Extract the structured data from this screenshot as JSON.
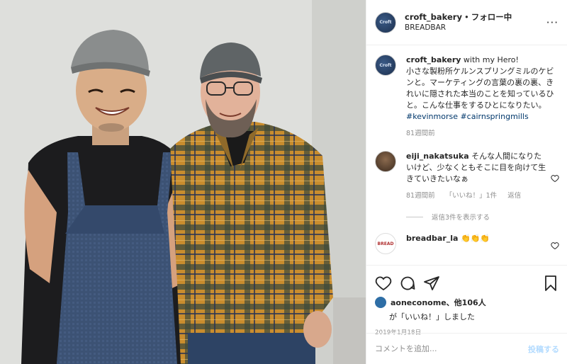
{
  "header": {
    "username": "croft_bakery",
    "separator": "•",
    "follow_status": "フォロー中",
    "location": "BREADBAR",
    "more": "···",
    "avatar_text": "Croft"
  },
  "caption": {
    "username": "croft_bakery",
    "text": "with my Hero!\n小さな製粉所ケルンスプリングミルのケビンと。マーケティングの言葉の裏の裏、きれいに隠された本当のことを知っているひと。こんな仕事をするひとになりたい。",
    "hashtags": "#kevinmorse #cairnspringmills",
    "time": "81週間前"
  },
  "comments": [
    {
      "username": "eiji_nakatsuka",
      "text": "そんな人間になりたいけど、少なくともそこに目を向けて生きていきたいなぁ",
      "time": "81週間前",
      "likes": "「いいね！」1件",
      "reply": "返信",
      "view_replies": "返信3件を表示する"
    },
    {
      "username": "breadbar_la",
      "text": "👏👏👏",
      "avatar_text": "BREAD"
    }
  ],
  "likes": {
    "names": "aoneconome、他106人",
    "suffix": "が「いいね！」しました"
  },
  "date": "2019年1月18日",
  "comment_box": {
    "placeholder": "コメントを追加...",
    "post": "投稿する"
  },
  "icons": [
    "heart-icon",
    "comment-icon",
    "share-icon",
    "bookmark-icon",
    "more-icon"
  ],
  "colors": {
    "link": "#00376b",
    "muted": "#8e8e8e",
    "post_disabled": "#b3dbff"
  }
}
